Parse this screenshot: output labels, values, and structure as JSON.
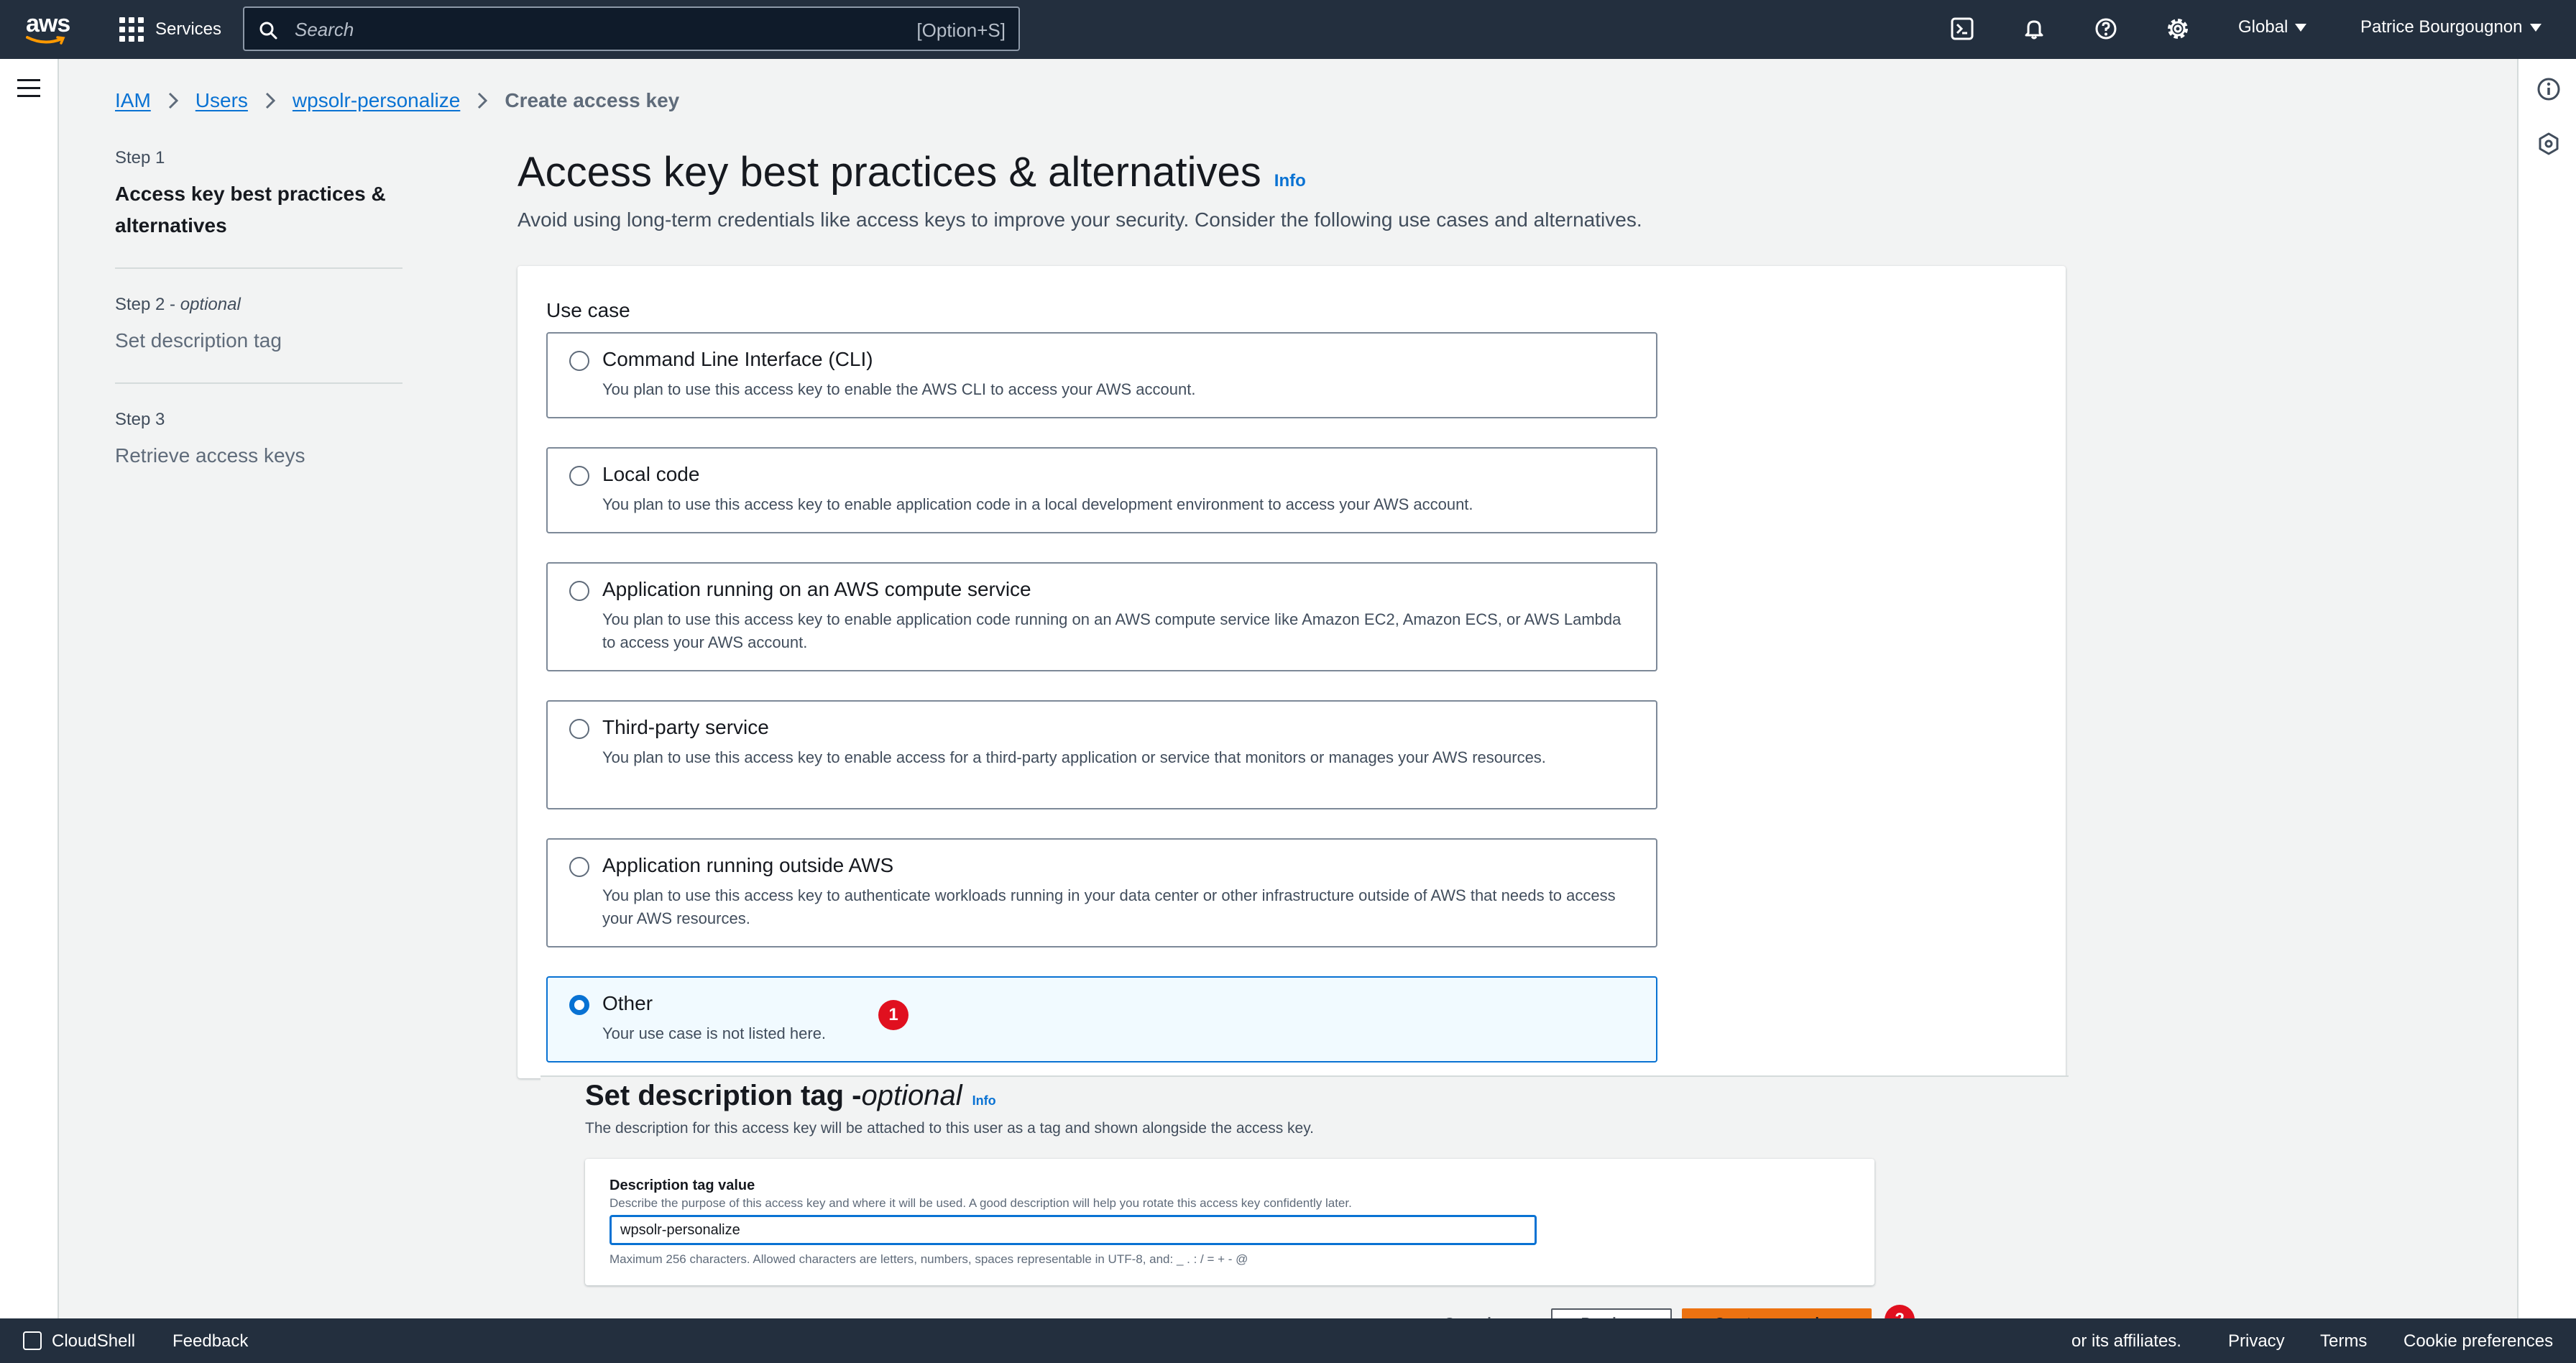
{
  "topnav": {
    "logo_text": "aws",
    "services_label": "Services",
    "search_placeholder": "Search",
    "search_shortcut": "[Option+S]",
    "region_label": "Global",
    "user_label": "Patrice Bourgougnon"
  },
  "breadcrumb": {
    "items": [
      "IAM",
      "Users",
      "wpsolr-personalize"
    ],
    "current": "Create access key"
  },
  "steps": [
    {
      "label": "Step 1",
      "optional": "",
      "title": "Access key best practices & alternatives"
    },
    {
      "label": "Step 2 - ",
      "optional": "optional",
      "title": "Set description tag"
    },
    {
      "label": "Step 3",
      "optional": "",
      "title": "Retrieve access keys"
    }
  ],
  "header": {
    "title": "Access key best practices & alternatives",
    "info": "Info",
    "description": "Avoid using long-term credentials like access keys to improve your security. Consider the following use cases and alternatives."
  },
  "use_case": {
    "label": "Use case",
    "options": [
      {
        "title": "Command Line Interface (CLI)",
        "description": "You plan to use this access key to enable the AWS CLI to access your AWS account.",
        "selected": false
      },
      {
        "title": "Local code",
        "description": "You plan to use this access key to enable application code in a local development environment to access your AWS account.",
        "selected": false
      },
      {
        "title": "Application running on an AWS compute service",
        "description": "You plan to use this access key to enable application code running on an AWS compute service like Amazon EC2, Amazon ECS, or AWS Lambda to access your AWS account.",
        "selected": false
      },
      {
        "title": "Third-party service",
        "description": "You plan to use this access key to enable access for a third-party application or service that monitors or manages your AWS resources.",
        "selected": false
      },
      {
        "title": "Application running outside AWS",
        "description": "You plan to use this access key to authenticate workloads running in your data center or other infrastructure outside of AWS that needs to access your AWS resources.",
        "selected": false
      },
      {
        "title": "Other",
        "description": "Your use case is not listed here.",
        "selected": true
      }
    ]
  },
  "annotations": {
    "badge1": "1",
    "badge2": "2"
  },
  "description_tag": {
    "title": "Set description tag - ",
    "optional": "optional",
    "info": "Info",
    "description": "The description for this access key will be attached to this user as a tag and shown alongside the access key.",
    "field_label": "Description tag value",
    "field_description": "Describe the purpose of this access key and where it will be used. A good description will help you rotate this access key confidently later.",
    "field_value": "wpsolr-personalize",
    "field_hint": "Maximum 256 characters. Allowed characters are letters, numbers, spaces representable in UTF-8, and: _ . : / = + - @"
  },
  "actions": {
    "cancel": "Cancel",
    "previous": "Previous",
    "create": "Create access key"
  },
  "footer": {
    "cloudshell": "CloudShell",
    "feedback": "Feedback",
    "copyright_fragment": "or its affiliates.",
    "privacy": "Privacy",
    "terms": "Terms",
    "cookie": "Cookie preferences"
  },
  "colors": {
    "nav_bg": "#232f3e",
    "link": "#0972d3",
    "primary_button": "#ec7211",
    "badge": "#e0101f"
  }
}
